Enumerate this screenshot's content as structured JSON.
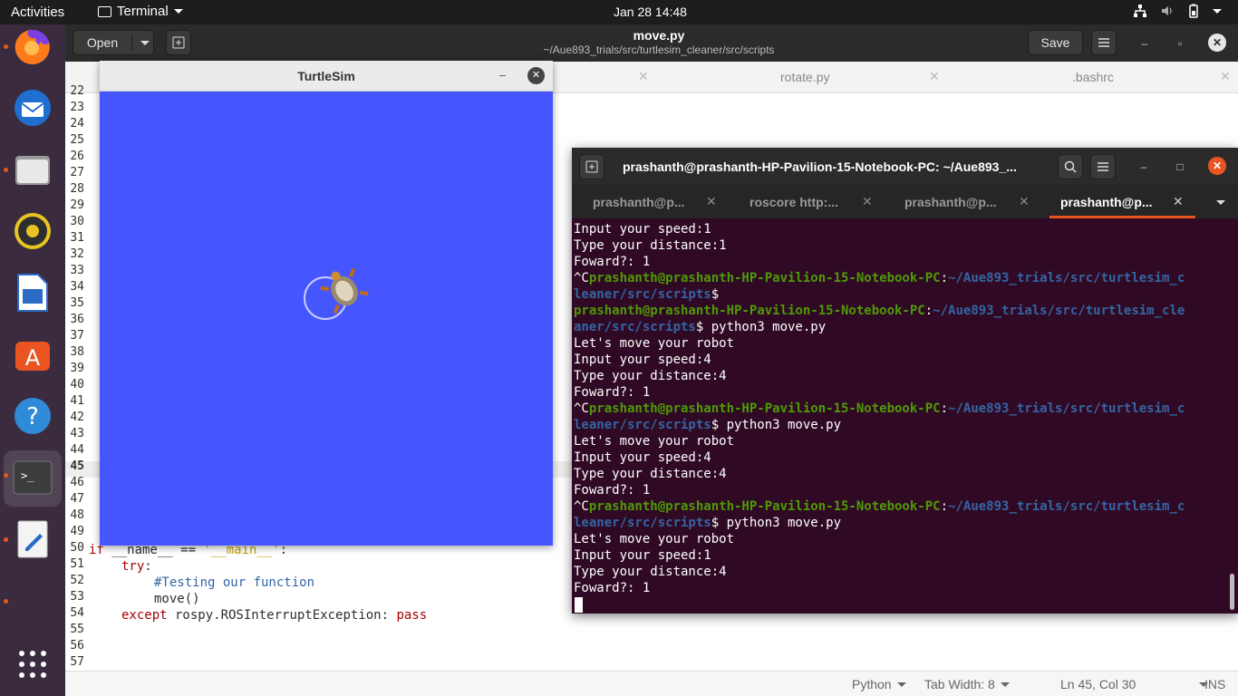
{
  "topbar": {
    "activities": "Activities",
    "app_menu": "Terminal",
    "clock": "Jan 28  14:48"
  },
  "dock": {
    "items": [
      "firefox-icon",
      "thunderbird-icon",
      "files-icon",
      "rhythmbox-icon",
      "libreoffice-writer-icon",
      "software-center-icon",
      "help-icon",
      "terminal-icon",
      "text-editor-icon",
      "show-apps-icon"
    ]
  },
  "gedit": {
    "open_label": "Open",
    "title": "move.py",
    "path": "~/Aue893_trials/src/turtlesim_cleaner/src/scripts",
    "save_label": "Save",
    "tabs": [
      "rotate.py",
      ".bashrc"
    ],
    "line_numbers": [
      "22",
      "23",
      "24",
      "25",
      "26",
      "27",
      "28",
      "29",
      "30",
      "31",
      "32",
      "33",
      "34",
      "35",
      "36",
      "37",
      "38",
      "39",
      "40",
      "41",
      "42",
      "43",
      "44",
      "45",
      "46",
      "47",
      "48",
      "49",
      "50",
      "51",
      "52",
      "53",
      "54",
      "55",
      "56",
      "57"
    ],
    "code": {
      "l50_kw": "if",
      "l50_a": " __name__ == ",
      "l50_str": "'__main__'",
      "l50_b": ":",
      "l51_kw": "try",
      "l51_b": ":",
      "l52": "#Testing our function",
      "l53": "move()",
      "l54_kw": "except",
      "l54_a": " rospy.ROSInterruptException: ",
      "l54_kw2": "pass"
    },
    "status": {
      "language": "Python",
      "tab_width": "Tab Width: 8",
      "position": "Ln 45, Col 30",
      "mode": "INS"
    }
  },
  "turtlesim": {
    "title": "TurtleSim",
    "background": "#4556ff"
  },
  "terminal": {
    "title": "prashanth@prashanth-HP-Pavilion-15-Notebook-PC: ~/Aue893_...",
    "tabs": [
      "prashanth@p...",
      "roscore http:...",
      "prashanth@p...",
      "prashanth@p..."
    ],
    "lines": {
      "l1": "Input your speed:1",
      "l2": "Type your distance:1",
      "l3": "Foward?: 1",
      "l4_pre": "^C",
      "user_host": "prashanth@prashanth-HP-Pavilion-15-Notebook-PC",
      "colon": ":",
      "path_wrap1a": "~/Aue893_trials/src/turtlesim_c",
      "path_wrap1b": "leaner/src/scripts",
      "path_wrap2a": "~/Aue893_trials/src/turtlesim_cle",
      "path_wrap2b": "aner/src/scripts",
      "dollar": "$",
      "cmd": "$ python3 move.py",
      "move_msg": "Let's move your robot",
      "speed4": "Input your speed:4",
      "dist4": "Type your distance:4",
      "fwd1": "Foward?: 1",
      "speed1": "Input your speed:1"
    }
  }
}
